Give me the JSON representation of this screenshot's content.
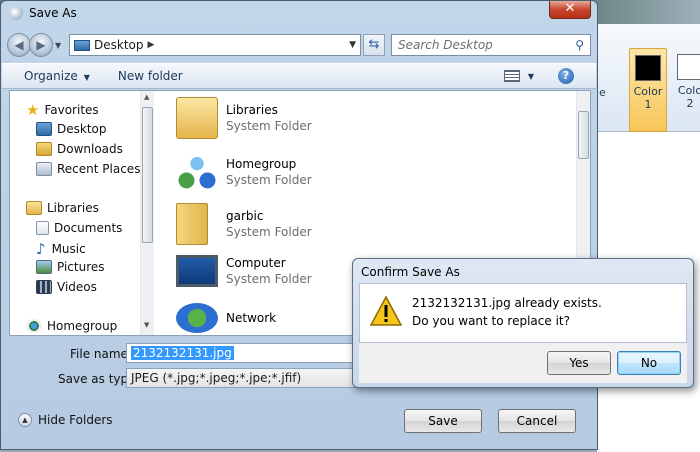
{
  "background_app": {
    "color1_label_a": "Color",
    "color1_label_b": "1",
    "color2_label_a": "Colo",
    "color2_label_b": "2",
    "color1_value": "#000000",
    "color2_value": "#ffffff",
    "ribbon_fragment": "e"
  },
  "window": {
    "title": "Save As",
    "close_glyph": "✕"
  },
  "address": {
    "crumb": "Desktop",
    "search_placeholder": "Search Desktop"
  },
  "toolbar": {
    "organize": "Organize",
    "new_folder": "New folder",
    "help_glyph": "?"
  },
  "sidebar": {
    "items": [
      {
        "label": "Favorites",
        "icon": "star-icon"
      },
      {
        "label": "Desktop",
        "icon": "desktop-icon"
      },
      {
        "label": "Downloads",
        "icon": "downloads-icon"
      },
      {
        "label": "Recent Places",
        "icon": "recent-places-icon"
      },
      {
        "label": "Libraries",
        "icon": "libraries-icon"
      },
      {
        "label": "Documents",
        "icon": "documents-icon"
      },
      {
        "label": "Music",
        "icon": "music-icon"
      },
      {
        "label": "Pictures",
        "icon": "pictures-icon"
      },
      {
        "label": "Videos",
        "icon": "videos-icon"
      },
      {
        "label": "Homegroup",
        "icon": "homegroup-icon"
      }
    ]
  },
  "files": [
    {
      "name": "Libraries",
      "type": "System Folder",
      "icon": "libraries-folder-icon"
    },
    {
      "name": "Homegroup",
      "type": "System Folder",
      "icon": "homegroup-icon"
    },
    {
      "name": "garbic",
      "type": "System Folder",
      "icon": "user-folder-icon"
    },
    {
      "name": "Computer",
      "type": "System Folder",
      "icon": "computer-icon"
    },
    {
      "name": "Network",
      "type": "",
      "icon": "network-icon"
    }
  ],
  "form": {
    "file_name_label": "File name:",
    "file_name_value": "2132132131.jpg",
    "save_type_label": "Save as type:",
    "save_type_value": "JPEG (*.jpg;*.jpeg;*.jpe;*.jfif)",
    "hide_folders": "Hide Folders",
    "save": "Save",
    "cancel": "Cancel"
  },
  "confirm": {
    "title": "Confirm Save As",
    "line1": "2132132131.jpg already exists.",
    "line2": "Do you want to replace it?",
    "yes": "Yes",
    "no": "No"
  }
}
